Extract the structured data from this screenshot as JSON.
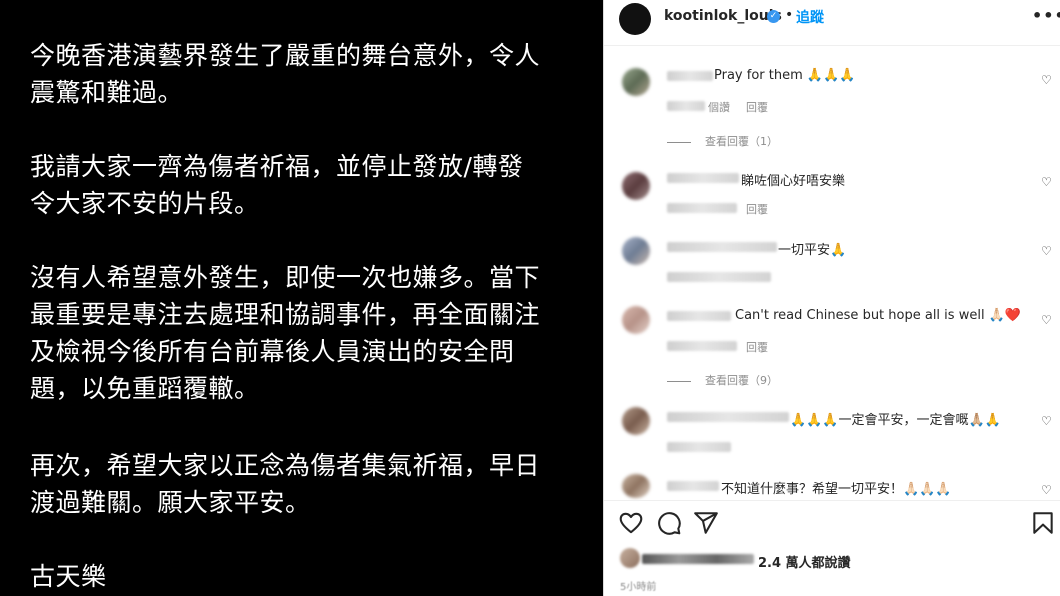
{
  "post": {
    "paragraphs": [
      "今晚香港演藝界發生了嚴重的舞台意外，令人\n震驚和難過。",
      "我請大家一齊為傷者祈福，並停止發放/轉發\n令大家不安的片段。",
      "沒有人希望意外發生，即使一次也嫌多。當下\n最重要是專注去處理和協調事件，再全面關注\n及檢視今後所有台前幕後人員演出的安全問\n題，以免重蹈覆轍。",
      "再次，希望大家以正念為傷者集氣祈福，早日\n渡過難關。願大家平安。",
      "古天樂"
    ]
  },
  "header": {
    "username": "kootinlok_louis",
    "verified_mark": "✓",
    "separator": "•",
    "follow_label": "追蹤",
    "more_icon": "•••"
  },
  "comments": [
    {
      "text": "Pray for them 🙏🙏🙏",
      "meta": "個讚",
      "reply": "回覆",
      "view_replies": "查看回覆（1）"
    },
    {
      "text": "睇咗個心好唔安樂",
      "meta": "",
      "reply": "回覆"
    },
    {
      "text": "一切平安🙏",
      "meta": "",
      "reply": ""
    },
    {
      "text": "Can't read Chinese but hope all is well 🙏🏻❤️",
      "meta": "",
      "reply": "回覆",
      "view_replies": "查看回覆（9）"
    },
    {
      "text": "🙏🙏🙏一定會平安，一定會嘅🙏🏼🙏",
      "meta": "",
      "reply": ""
    },
    {
      "text": "不知道什麼事？希望一切平安！🙏🏻🙏🏻🙏🏻",
      "meta": "",
      "reply": ""
    }
  ],
  "actions": {
    "like_icon": "heart-outline",
    "comment_icon": "speech-bubble",
    "share_icon": "paper-plane",
    "save_icon": "bookmark"
  },
  "likes": {
    "text": "2.4 萬人都說讚"
  },
  "time": {
    "text": "5小時前"
  },
  "colors": {
    "follow": "#0095f6",
    "verified": "#3897f0",
    "post_bg": "#000000"
  }
}
